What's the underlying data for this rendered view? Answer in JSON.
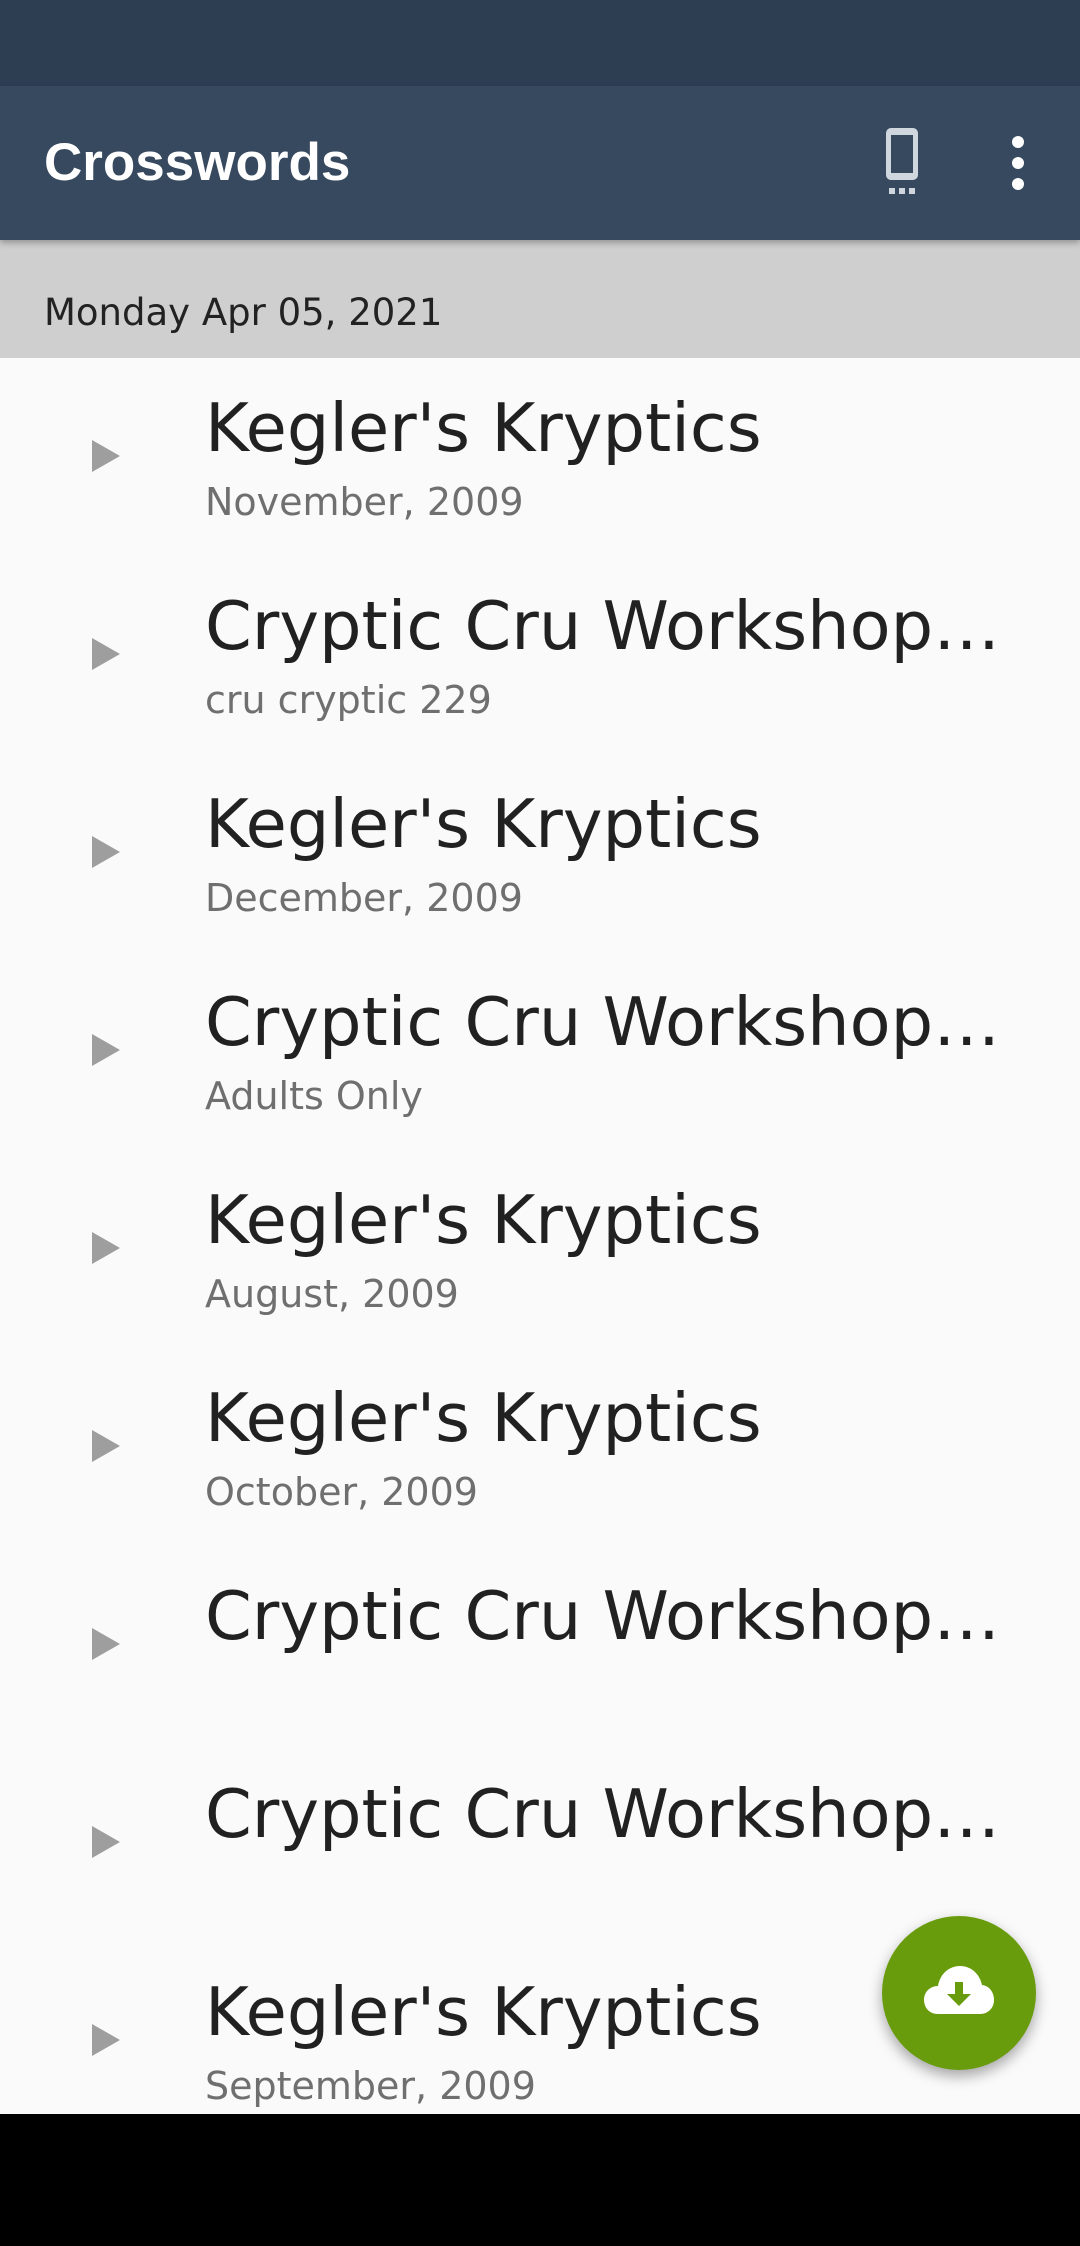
{
  "app_bar": {
    "title": "Crosswords",
    "device_icon": "phone-icon",
    "menu_icon": "more-vert-icon"
  },
  "date_header": "Monday Apr 05, 2021",
  "puzzles": [
    {
      "title": "Kegler's Kryptics",
      "subtitle": "November, 2009"
    },
    {
      "title": "Cryptic Cru Workshop Archive",
      "subtitle": "cru cryptic 229"
    },
    {
      "title": "Kegler's Kryptics",
      "subtitle": "December, 2009"
    },
    {
      "title": "Cryptic Cru Workshop Archive",
      "subtitle": "Adults Only"
    },
    {
      "title": "Kegler's Kryptics",
      "subtitle": "August, 2009"
    },
    {
      "title": "Kegler's Kryptics",
      "subtitle": "October, 2009"
    },
    {
      "title": "Cryptic Cru Workshop Archive",
      "subtitle": ""
    },
    {
      "title": "Cryptic Cru Workshop Archive",
      "subtitle": ""
    },
    {
      "title": "Kegler's Kryptics",
      "subtitle": "September, 2009"
    }
  ],
  "fab": {
    "icon": "cloud-download-icon",
    "color": "#689c0c"
  },
  "colors": {
    "app_bar": "#37495f",
    "status_bar": "#2e3e52",
    "date_header": "#cfcfcf"
  }
}
